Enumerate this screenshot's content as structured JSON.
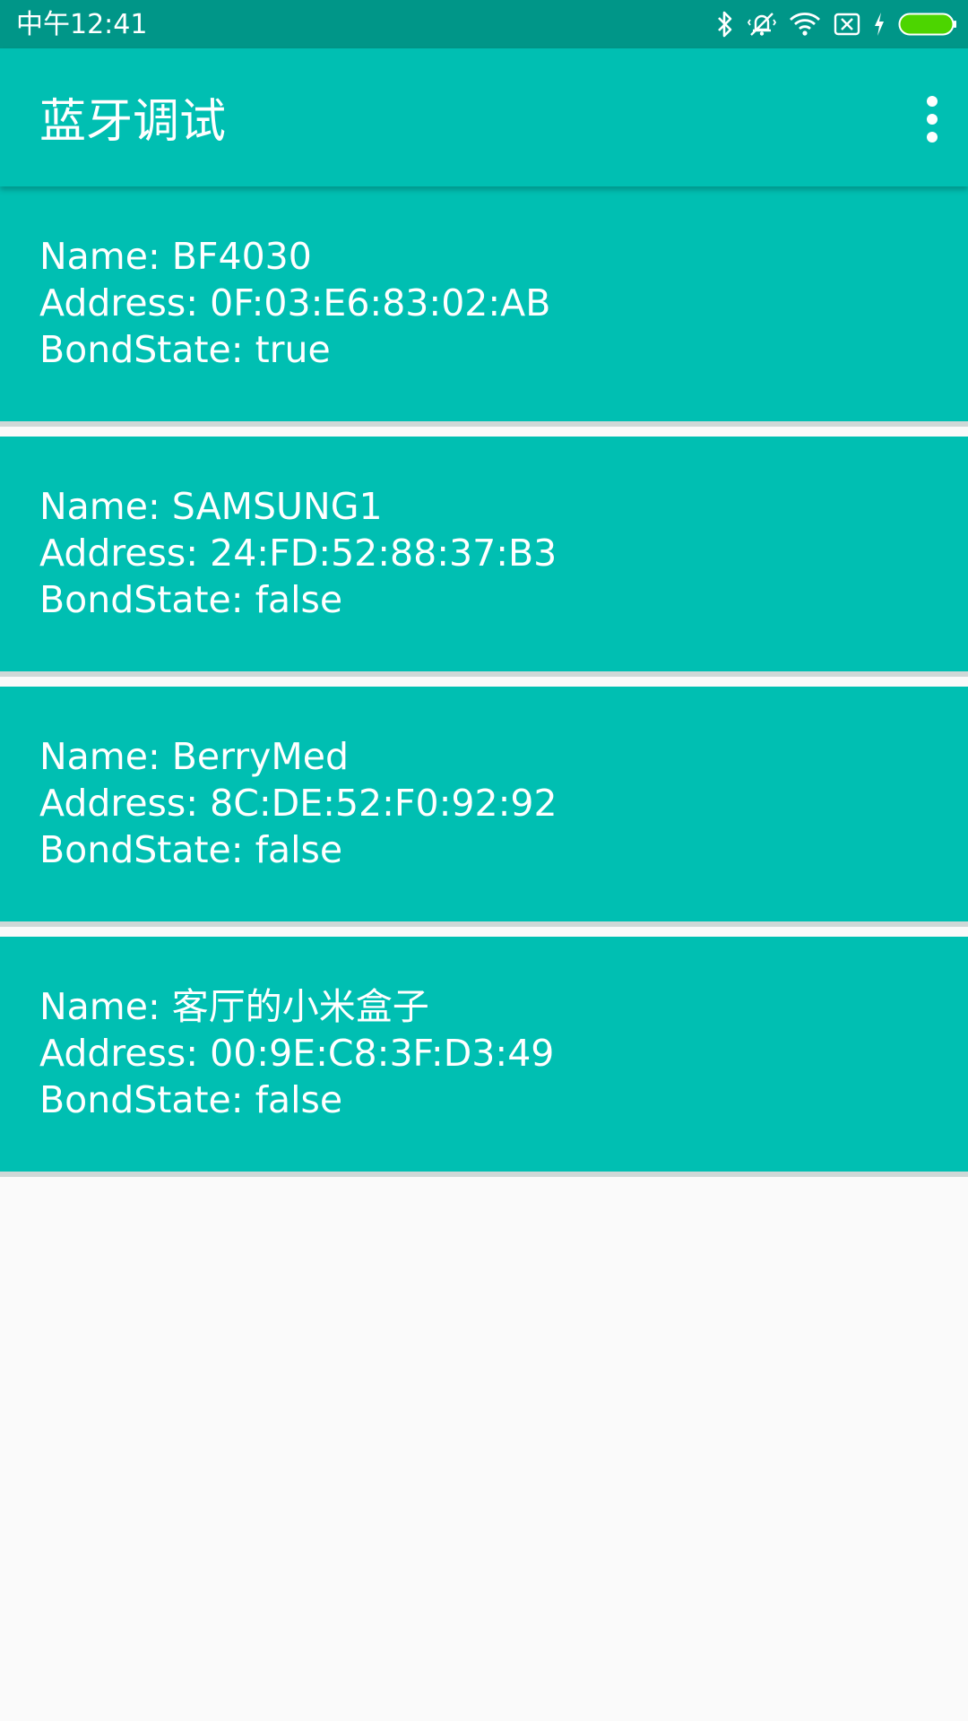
{
  "status_bar": {
    "time": "中午12:41",
    "icons": [
      "bluetooth-icon",
      "mute-vibrate-icon",
      "wifi-icon",
      "no-sim-icon",
      "charging-icon",
      "battery-icon"
    ],
    "battery_color": "#4cd500"
  },
  "app_bar": {
    "title": "蓝牙调试",
    "background": "#00bfb2",
    "menu_icon": "more-vert-icon"
  },
  "devices": [
    {
      "name": "Name: BF4030",
      "address": "Address: 0F:03:E6:83:02:AB",
      "bond_state": "BondState: true"
    },
    {
      "name": "Name: SAMSUNG1",
      "address": "Address: 24:FD:52:88:37:B3",
      "bond_state": "BondState: false"
    },
    {
      "name": "Name: BerryMed",
      "address": "Address: 8C:DE:52:F0:92:92",
      "bond_state": "BondState: false"
    },
    {
      "name": "Name: 客厅的小米盒子",
      "address": "Address: 00:9E:C8:3F:D3:49",
      "bond_state": "BondState: false"
    }
  ]
}
